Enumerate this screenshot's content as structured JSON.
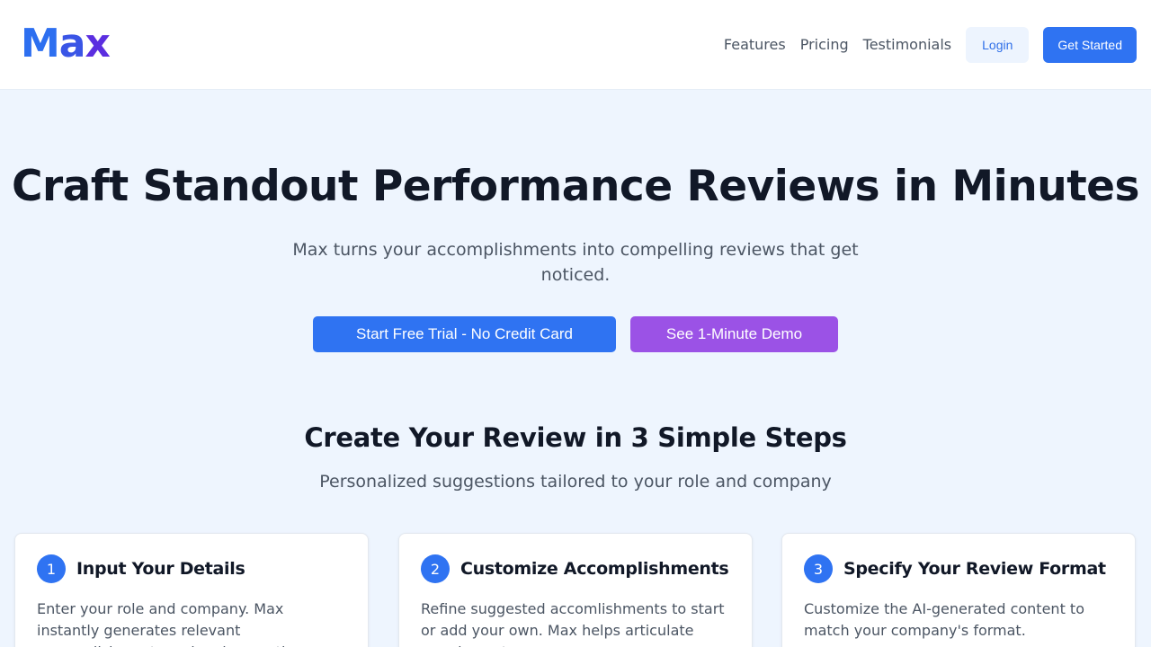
{
  "brand": {
    "logo_letters": [
      "M",
      "a",
      "x"
    ]
  },
  "nav": {
    "links": [
      "Features",
      "Pricing",
      "Testimonials"
    ],
    "login_label": "Login",
    "get_started_label": "Get Started"
  },
  "hero": {
    "title": "Craft Standout Performance Reviews in Minutes",
    "subtitle": "Max turns your accomplishments into compelling reviews that get noticed.",
    "primary_cta": "Start Free Trial - No Credit Card",
    "secondary_cta": "See 1-Minute Demo"
  },
  "steps": {
    "title": "Create Your Review in 3 Simple Steps",
    "subtitle": "Personalized suggestions tailored to your role and company",
    "items": [
      {
        "number": "1",
        "title": "Input Your Details",
        "text": "Enter your role and company. Max instantly generates relevant accomplishments and review sections."
      },
      {
        "number": "2",
        "title": "Customize Accomplishments",
        "text": "Refine suggested accomlishments to start or add your own. Max helps articulate your impact."
      },
      {
        "number": "3",
        "title": "Specify Your Review Format",
        "text": "Customize the AI-generated content to match your company's format."
      }
    ]
  },
  "colors": {
    "primary": "#2f73f2",
    "demo": "#9b52e6",
    "background": "#eef5fe"
  }
}
